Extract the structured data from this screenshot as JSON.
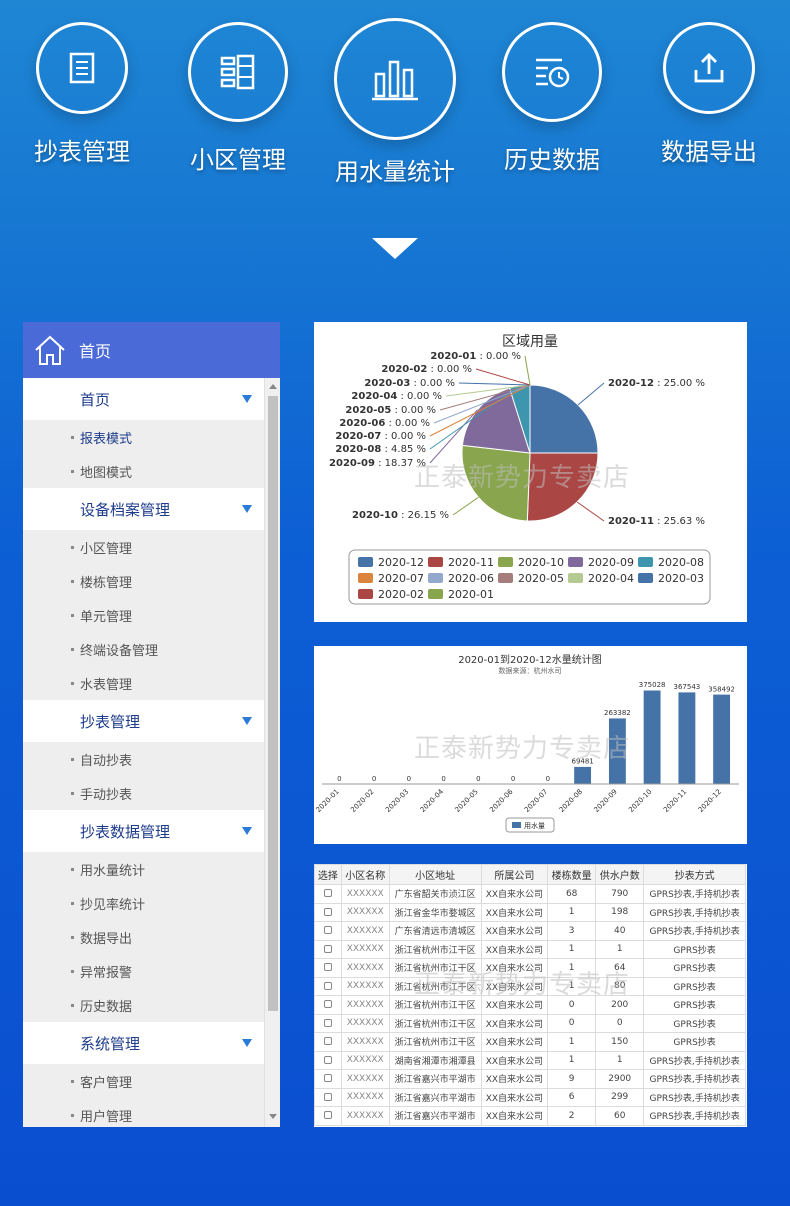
{
  "features": [
    {
      "label": "抄表管理",
      "icon": "checklist-icon"
    },
    {
      "label": "小区管理",
      "icon": "building-grid-icon"
    },
    {
      "label": "用水量统计",
      "icon": "bar-chart-icon"
    },
    {
      "label": "历史数据",
      "icon": "history-clock-icon"
    },
    {
      "label": "数据导出",
      "icon": "upload-export-icon"
    }
  ],
  "sidebar": {
    "header": "首页",
    "groups": [
      {
        "label": "首页",
        "items": [
          "报表模式",
          "地图模式"
        ]
      },
      {
        "label": "设备档案管理",
        "items": [
          "小区管理",
          "楼栋管理",
          "单元管理",
          "终端设备管理",
          "水表管理"
        ]
      },
      {
        "label": "抄表管理",
        "items": [
          "自动抄表",
          "手动抄表"
        ]
      },
      {
        "label": "抄表数据管理",
        "items": [
          "用水量统计",
          "抄见率统计",
          "数据导出",
          "异常报警",
          "历史数据"
        ]
      },
      {
        "label": "系统管理",
        "items": [
          "客户管理",
          "用户管理"
        ]
      }
    ]
  },
  "watermark": "正泰新势力专卖店",
  "colors": {
    "palette": [
      "#4572a7",
      "#aa4643",
      "#89a54e",
      "#80699b",
      "#3d96ae",
      "#db843d",
      "#92a8cd",
      "#a47d7c",
      "#b5ca92"
    ]
  },
  "pie_chart": {
    "chart_data": {
      "type": "pie",
      "title": "区域用量",
      "slices": [
        {
          "label": "2020-12",
          "value": 25.0,
          "text": "2020-12 : 25.00 %",
          "color": "#4572a7"
        },
        {
          "label": "2020-11",
          "value": 25.63,
          "text": "2020-11 : 25.63 %",
          "color": "#aa4643"
        },
        {
          "label": "2020-10",
          "value": 26.15,
          "text": "2020-10 : 26.15 %",
          "color": "#89a54e"
        },
        {
          "label": "2020-09",
          "value": 18.37,
          "text": "2020-09 : 18.37 %",
          "color": "#80699b"
        },
        {
          "label": "2020-08",
          "value": 4.85,
          "text": "2020-08 : 4.85 %",
          "color": "#3d96ae"
        },
        {
          "label": "2020-07",
          "value": 0.0,
          "text": "2020-07 : 0.00 %",
          "color": "#db843d"
        },
        {
          "label": "2020-06",
          "value": 0.0,
          "text": "2020-06 : 0.00 %",
          "color": "#92a8cd"
        },
        {
          "label": "2020-05",
          "value": 0.0,
          "text": "2020-05 : 0.00 %",
          "color": "#a47d7c"
        },
        {
          "label": "2020-04",
          "value": 0.0,
          "text": "2020-04 : 0.00 %",
          "color": "#b5ca92"
        },
        {
          "label": "2020-03",
          "value": 0.0,
          "text": "2020-03 : 0.00 %",
          "color": "#4572a7"
        },
        {
          "label": "2020-02",
          "value": 0.0,
          "text": "2020-02 : 0.00 %",
          "color": "#aa4643"
        },
        {
          "label": "2020-01",
          "value": 0.0,
          "text": "2020-01 : 0.00 %",
          "color": "#89a54e"
        }
      ],
      "legend_order": [
        "2020-12",
        "2020-11",
        "2020-10",
        "2020-09",
        "2020-08",
        "2020-07",
        "2020-06",
        "2020-05",
        "2020-04",
        "2020-03",
        "2020-02",
        "2020-01"
      ],
      "legend": "bottom"
    }
  },
  "bar_chart": {
    "chart_data": {
      "type": "bar",
      "title": "2020-01到2020-12水量统计图",
      "subtitle": "数据来源：杭州水司",
      "categories": [
        "2020-01",
        "2020-02",
        "2020-03",
        "2020-04",
        "2020-05",
        "2020-06",
        "2020-07",
        "2020-08",
        "2020-09",
        "2020-10",
        "2020-11",
        "2020-12"
      ],
      "series": [
        {
          "name": "用水量",
          "values": [
            0,
            0,
            0,
            0,
            0,
            0,
            0,
            69481,
            263382,
            375028,
            367543,
            358492
          ],
          "color": "#4572a7"
        }
      ],
      "ylim": [
        0,
        400000
      ],
      "legend": "bottom"
    }
  },
  "table": {
    "headers": [
      "选择",
      "小区名称",
      "小区地址",
      "所属公司",
      "楼栋数量",
      "供水户数",
      "抄表方式"
    ],
    "rows": [
      [
        "",
        "XXXXXX",
        "广东省韶关市浈江区",
        "XX自来水公司",
        "68",
        "790",
        "GPRS抄表,手持机抄表"
      ],
      [
        "",
        "XXXXXX",
        "浙江省金华市婺城区",
        "XX自来水公司",
        "1",
        "198",
        "GPRS抄表,手持机抄表"
      ],
      [
        "",
        "XXXXXX",
        "广东省清远市清城区",
        "XX自来水公司",
        "3",
        "40",
        "GPRS抄表,手持机抄表"
      ],
      [
        "",
        "XXXXXX",
        "浙江省杭州市江干区",
        "XX自来水公司",
        "1",
        "1",
        "GPRS抄表"
      ],
      [
        "",
        "XXXXXX",
        "浙江省杭州市江干区",
        "XX自来水公司",
        "1",
        "64",
        "GPRS抄表"
      ],
      [
        "",
        "XXXXXX",
        "浙江省杭州市江干区",
        "XX自来水公司",
        "1",
        "80",
        "GPRS抄表"
      ],
      [
        "",
        "XXXXXX",
        "浙江省杭州市江干区",
        "XX自来水公司",
        "0",
        "200",
        "GPRS抄表"
      ],
      [
        "",
        "XXXXXX",
        "浙江省杭州市江干区",
        "XX自来水公司",
        "0",
        "0",
        "GPRS抄表"
      ],
      [
        "",
        "XXXXXX",
        "浙江省杭州市江干区",
        "XX自来水公司",
        "1",
        "150",
        "GPRS抄表"
      ],
      [
        "",
        "XXXXXX",
        "湖南省湘潭市湘潭县",
        "XX自来水公司",
        "1",
        "1",
        "GPRS抄表,手持机抄表"
      ],
      [
        "",
        "XXXXXX",
        "浙江省嘉兴市平湖市",
        "XX自来水公司",
        "9",
        "2900",
        "GPRS抄表,手持机抄表"
      ],
      [
        "",
        "XXXXXX",
        "浙江省嘉兴市平湖市",
        "XX自来水公司",
        "6",
        "299",
        "GPRS抄表,手持机抄表"
      ],
      [
        "",
        "XXXXXX",
        "浙江省嘉兴市平湖市",
        "XX自来水公司",
        "2",
        "60",
        "GPRS抄表,手持机抄表"
      ]
    ]
  }
}
